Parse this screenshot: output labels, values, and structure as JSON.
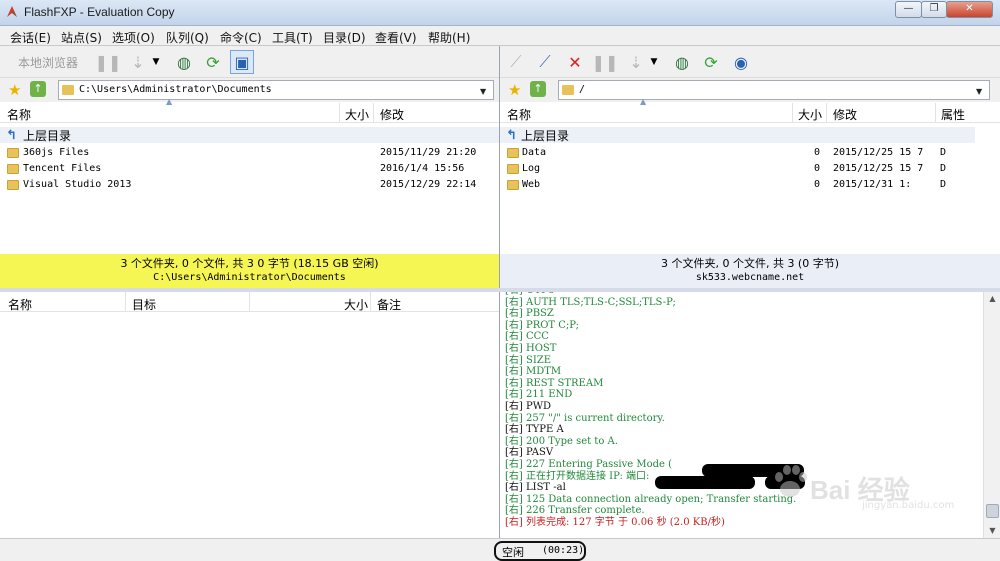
{
  "window": {
    "title": "FlashFXP - Evaluation Copy",
    "min": "—",
    "max": "❐",
    "close": "✕"
  },
  "menu": [
    "会话(E)",
    "站点(S)",
    "选项(O)",
    "队列(Q)",
    "命令(C)",
    "工具(T)",
    "目录(D)",
    "查看(V)",
    "帮助(H)"
  ],
  "left": {
    "toolbar_label": "本地浏览器",
    "path": "C:\\Users\\Administrator\\Documents",
    "columns": {
      "name": "名称",
      "size": "大小",
      "modified": "修改"
    },
    "parent": "上层目录",
    "rows": [
      {
        "name": "360js Files",
        "date": "2015/11/29 21:20"
      },
      {
        "name": "Tencent Files",
        "date": "2016/1/4 15:56"
      },
      {
        "name": "Visual Studio 2013",
        "date": "2015/12/29 22:14"
      }
    ],
    "status_line1": "3 个文件夹, 0 个文件, 共 3 0 字节 (18.15 GB 空闲)",
    "status_line2": "C:\\Users\\Administrator\\Documents"
  },
  "right": {
    "path": "/",
    "columns": {
      "name": "名称",
      "size": "大小",
      "modified": "修改",
      "attr": "属性"
    },
    "parent": "上层目录",
    "rows": [
      {
        "name": "Data",
        "size": "0",
        "date": "2015/12/25 15  7",
        "attr": "D"
      },
      {
        "name": "Log",
        "size": "0",
        "date": "2015/12/25 15  7",
        "attr": "D"
      },
      {
        "name": "Web",
        "size": "0",
        "date": "2015/12/31 1:",
        "attr": "D"
      }
    ],
    "status_line1": "3 个文件夹, 0 个文件, 共 3 (0 字节)",
    "status_line2": "sk533.webcname.net"
  },
  "queue": {
    "columns": {
      "name": "名称",
      "target": "目标",
      "size": "大小",
      "note": "备注"
    }
  },
  "log": [
    {
      "text": "[右]  UTF8",
      "c": "g"
    },
    {
      "text": "[右]  AUTH TLS;TLS-C;SSL;TLS-P;",
      "c": "g"
    },
    {
      "text": "[右]  PBSZ",
      "c": "g"
    },
    {
      "text": "[右]  PROT C;P;",
      "c": "g"
    },
    {
      "text": "[右]  CCC",
      "c": "g"
    },
    {
      "text": "[右]  HOST",
      "c": "g"
    },
    {
      "text": "[右]  SIZE",
      "c": "g"
    },
    {
      "text": "[右]  MDTM",
      "c": "g"
    },
    {
      "text": "[右]  REST STREAM",
      "c": "g"
    },
    {
      "text": "[右] 211 END",
      "c": "g"
    },
    {
      "text": "[右] PWD",
      "c": "b"
    },
    {
      "text": "[右] 257 \"/\" is current directory.",
      "c": "g"
    },
    {
      "text": "[右] TYPE A",
      "c": "b"
    },
    {
      "text": "[右] 200 Type set to A.",
      "c": "g"
    },
    {
      "text": "[右] PASV",
      "c": "b"
    },
    {
      "text": "[右] 227 Entering Passive Mode (",
      "c": "g"
    },
    {
      "text": "[右] 正在打开数据连接 IP:                    端口:",
      "c": "g"
    },
    {
      "text": "[右] LIST -al",
      "c": "b"
    },
    {
      "text": "[右] 125 Data connection already open; Transfer starting.",
      "c": "g"
    },
    {
      "text": "[右] 226 Transfer complete.",
      "c": "g"
    },
    {
      "text": "[右] 列表完成: 127 字节 于 0.06 秒 (2.0 KB/秒)",
      "c": "r"
    }
  ],
  "statusbar": {
    "state": "空闲",
    "time": "(00:23)"
  },
  "watermark": {
    "text": "Bai 经验",
    "sub": "jingyan.baidu.com"
  }
}
